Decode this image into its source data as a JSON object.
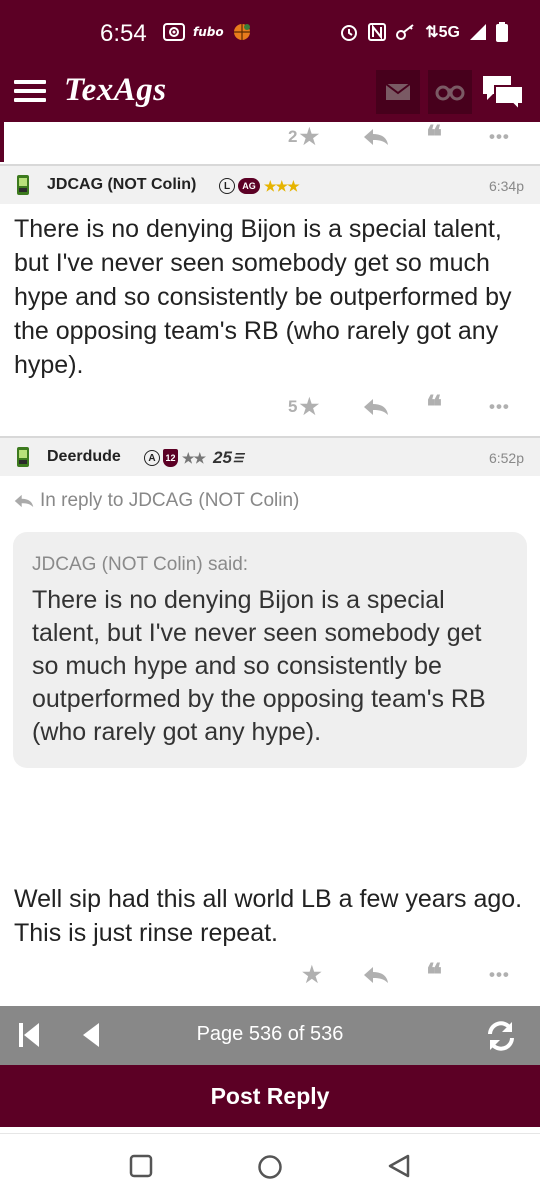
{
  "status_bar": {
    "time": "6:54",
    "app_icon_label": "fubo",
    "network": "5G",
    "icons": [
      "cast-icon",
      "fubo-icon",
      "basketball-icon",
      "alarm-icon",
      "nfc-icon",
      "key-icon",
      "signal-icon",
      "battery-icon"
    ]
  },
  "header": {
    "logo": "TexAgs",
    "icons": [
      "menu-icon",
      "mail-icon",
      "binoculars-icon",
      "chat-icon"
    ]
  },
  "previous_post": {
    "stars": "2"
  },
  "posts": [
    {
      "author": "JDCAG (NOT Colin)",
      "badges": [
        "L",
        "AG"
      ],
      "rating_stars": "★★★",
      "time": "6:34p",
      "body": "There is no denying Bijon is a special talent, but I've never seen somebody get so much hype and so consistently be outperformed by the opposing team's RB (who rarely got any hype).",
      "stars": "5"
    },
    {
      "author": "Deerdude",
      "badges": [
        "A",
        "12"
      ],
      "rating_stars": "★★",
      "extra": "25",
      "time": "6:52p",
      "reply_to": "In reply to JDCAG (NOT Colin)",
      "quote_said": "JDCAG (NOT Colin) said:",
      "quote_text": "There is no denying Bijon is a special talent, but I've never seen somebody get so much hype and so consistently be outperformed by the opposing team's RB (who rarely got any hype).",
      "body": "Well sip had this all world LB a few years ago. This is just rinse repeat.",
      "stars": ""
    }
  ],
  "pager": {
    "text": "Page 536 of 536"
  },
  "post_reply_label": "Post Reply",
  "colors": {
    "maroon": "#5c0025",
    "dark_maroon": "#47001c",
    "gold": "#e6b400",
    "pager_gray": "#888888"
  }
}
